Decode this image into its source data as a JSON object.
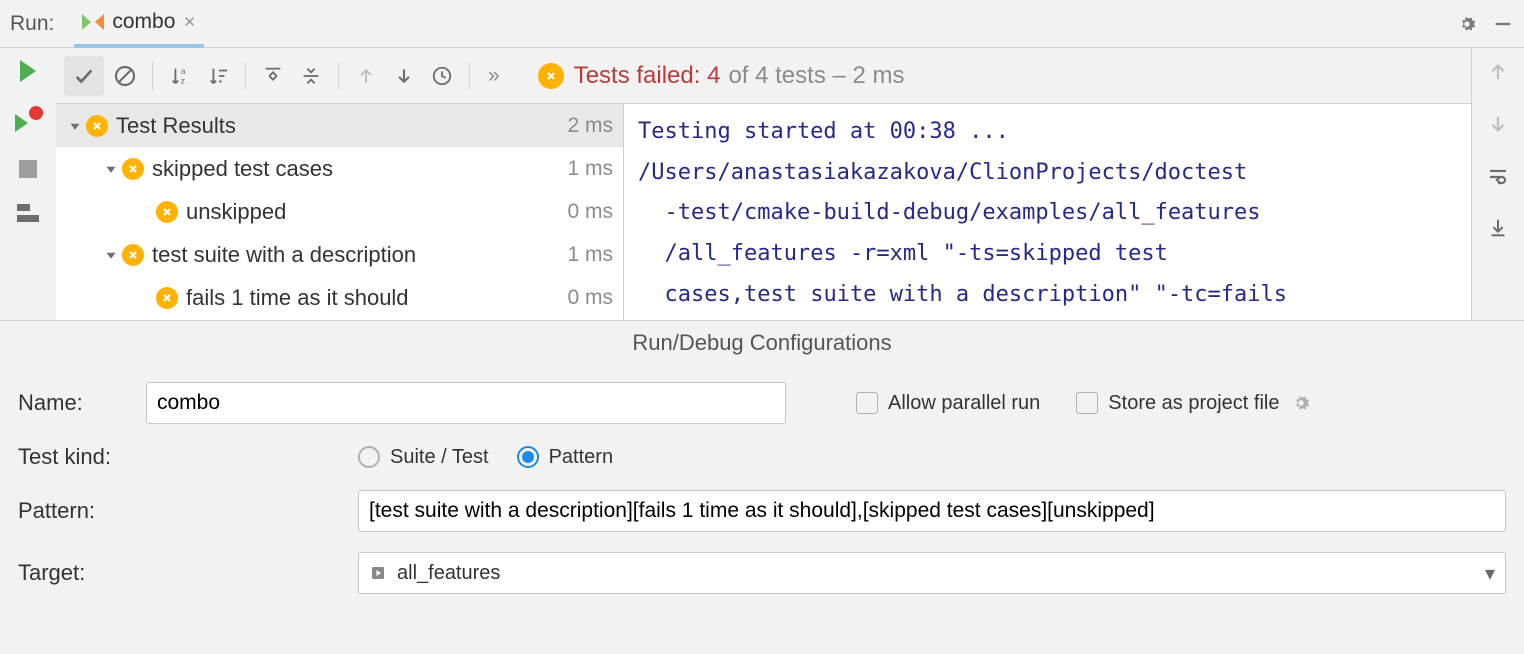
{
  "topbar": {
    "run_label": "Run:",
    "tab_name": "combo"
  },
  "toolbar": {
    "status_fail": "Tests failed: 4",
    "status_rest": "of 4 tests – 2 ms",
    "chevrons": "»"
  },
  "tree": {
    "root": {
      "label": "Test Results",
      "time": "2 ms"
    },
    "items": [
      {
        "label": "skipped test cases",
        "time": "1 ms",
        "indent": 1,
        "arrow": true
      },
      {
        "label": "unskipped",
        "time": "0 ms",
        "indent": 2,
        "arrow": false
      },
      {
        "label": "test suite with a description",
        "time": "1 ms",
        "indent": 1,
        "arrow": true
      },
      {
        "label": "fails 1 time as it should",
        "time": "0 ms",
        "indent": 2,
        "arrow": false
      }
    ]
  },
  "console": "Testing started at 00:38 ...\n/Users/anastasiakazakova/ClionProjects/doctest\n  -test/cmake-build-debug/examples/all_features\n  /all_features -r=xml \"-ts=skipped test \n  cases,test suite with a description\" \"-tc=fails",
  "config": {
    "title": "Run/Debug Configurations",
    "name_label": "Name:",
    "name_value": "combo",
    "allow_parallel": "Allow parallel run",
    "store_project": "Store as project file",
    "testkind_label": "Test kind:",
    "radio_suite": "Suite / Test",
    "radio_pattern": "Pattern",
    "pattern_label": "Pattern:",
    "pattern_value": "[test suite with a description][fails 1 time as it should],[skipped test cases][unskipped]",
    "target_label": "Target:",
    "target_value": "all_features"
  }
}
